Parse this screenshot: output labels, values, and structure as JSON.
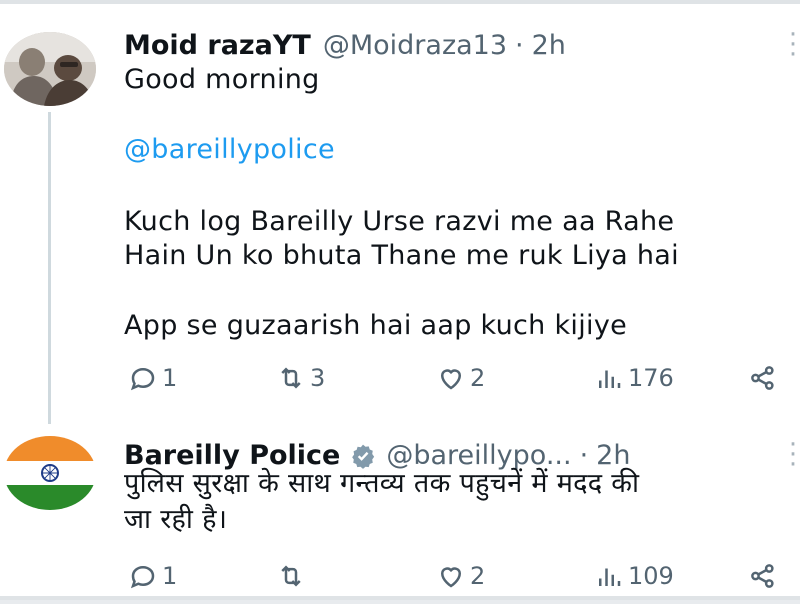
{
  "tweets": [
    {
      "display_name": "Moid razaYT",
      "handle": "@Moidraza13",
      "dot": "·",
      "time": "2h",
      "text_lines": [
        "Good morning",
        "@bareillypolice",
        "Kuch log Bareilly Urse razvi me aa Rahe",
        "Hain Un ko bhuta Thane me ruk Liya hai",
        "App se guzaarish hai aap kuch kijiye"
      ],
      "stats": {
        "replies": "1",
        "reposts": "3",
        "likes": "2",
        "views": "176"
      },
      "icons": [
        "reply-icon",
        "repost-icon",
        "like-icon",
        "views-icon",
        "share-icon",
        "more-icon"
      ]
    },
    {
      "display_name": "Bareilly Police",
      "verified": true,
      "handle": "@bareillypo...",
      "dot": "·",
      "time": "2h",
      "text_lines": [
        "पुलिस सुरक्षा के साथ गन्तव्य तक पहुचनें में मदद की",
        "जा रही है।"
      ],
      "stats": {
        "replies": "1",
        "reposts": "",
        "likes": "2",
        "views": "109"
      },
      "icons": [
        "reply-icon",
        "repost-icon",
        "like-icon",
        "views-icon",
        "share-icon",
        "more-icon"
      ]
    }
  ],
  "colors": {
    "text": "#0f1419",
    "secondary": "#536471",
    "link": "#1d9bf0",
    "thread": "#cfd9de"
  }
}
